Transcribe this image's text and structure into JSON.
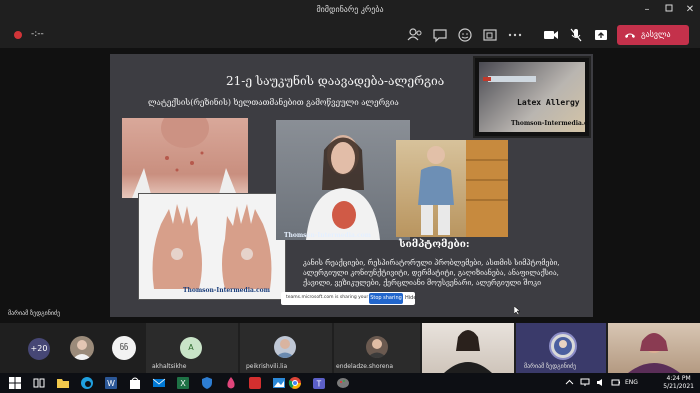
{
  "window": {
    "title": "მიმდინარე კრება"
  },
  "toolbar": {
    "timer": "-:--",
    "leave_label": "გასვლა"
  },
  "slide": {
    "title": "21-ე საუკუნის დაავადება-ალერგია",
    "subtitle": "ლატექსის(რეზინის) ხელთათმანებით გამოწვეული ალერგია",
    "latex_label": "Latex Allergy",
    "watermark": "Thomson-Intermedia.com",
    "symptoms_heading": "სიმპტომები:",
    "symptoms_text": "კანის რეაქციები, რესპირატორული პრობლემები, ასთმის სიმპტომები, ალერგიული კონიუნქტივიტი, დერმატიტი, გაღიზიანება, ანაფილაქსია, ქავილი, ვეზიკულები, ქერცლიანი მოუსვენარი, ალერგიული შოკი"
  },
  "share_bar": {
    "message": "teams.microsoft.com is sharing your screen.",
    "stop_label": "Stop sharing",
    "hide_label": "Hide"
  },
  "presenter_caption": "მარიამ ზედგინიძე",
  "participants": {
    "overflow_count": "+20",
    "initials_1": "ნნ",
    "initials_2": "A",
    "name_1": "akhaltsikhe",
    "name_2": "peikrishvili.lia",
    "name_3": "endeladze.shorena",
    "name_4": "მარიამ ზედგინიძე"
  },
  "taskbar": {
    "language": "ENG",
    "time": "4:24 PM",
    "date": "5/21/2021"
  },
  "colors": {
    "teams_dark": "#1f1f1f",
    "leave_red": "#c4314b",
    "record_red": "#d13438",
    "share_blue": "#2266cc",
    "slide_bg": "#3d3d42"
  }
}
